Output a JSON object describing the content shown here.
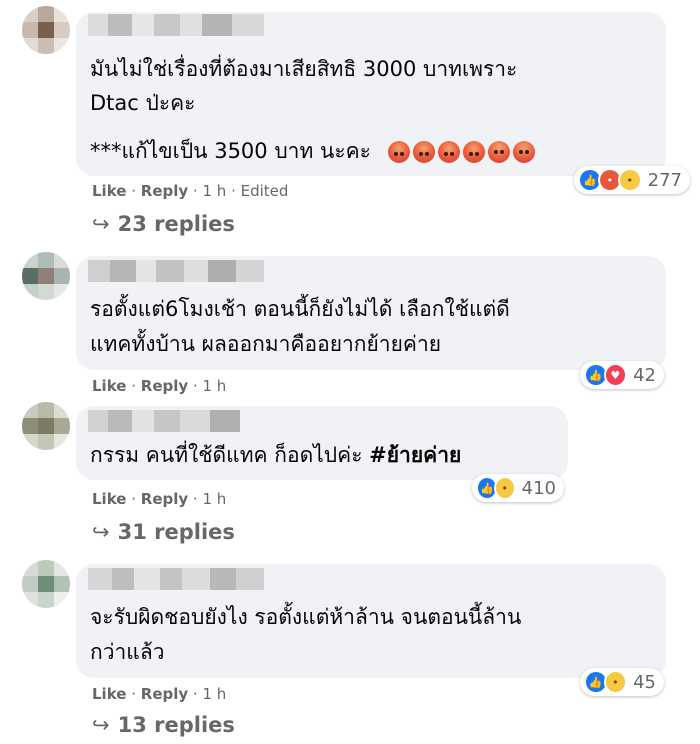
{
  "colors": {
    "bubble": "#f0f2f5",
    "meta": "#65676b",
    "text": "#050505",
    "like": "#1877f2"
  },
  "comments": [
    {
      "lines": [
        "มันไม่ใช่เรื่องที่ต้องมาเสียสิทธิ 3000 บาทเพราะ",
        "Dtac ป่ะคะ",
        "***แก้ไขเป็น 3500 บาท นะคะ"
      ],
      "emoji_count": 6,
      "actions": {
        "like": "Like",
        "reply": "Reply",
        "time": "1 h",
        "edited": "Edited"
      },
      "reaction_icons": [
        "like-icon",
        "angry-icon",
        "sad-icon"
      ],
      "reaction_count": "277",
      "replies": "23 replies"
    },
    {
      "lines": [
        "รอตั้งแต่6โมงเช้า ตอนนี้ก็ยังไม่ได้ เลือกใช้แต่ดี",
        "แทคทั้งบ้าน ผลออกมาคืออยากย้ายค่าย"
      ],
      "actions": {
        "like": "Like",
        "reply": "Reply",
        "time": "1 h"
      },
      "reaction_icons": [
        "like-icon",
        "love-icon"
      ],
      "reaction_count": "42"
    },
    {
      "lines": [
        "กรรม คนที่ใช้ดีแทค ก็อดไปค่ะ",
        "#ย้ายค่าย"
      ],
      "actions": {
        "like": "Like",
        "reply": "Reply",
        "time": "1 h"
      },
      "reaction_icons": [
        "like-icon",
        "sad-icon"
      ],
      "reaction_count": "410",
      "replies": "31 replies"
    },
    {
      "lines": [
        "จะรับผิดชอบยังไง รอตั้งแต่ห้าล้าน จนตอนนี้ล้าน",
        "กว่าแล้ว"
      ],
      "actions": {
        "like": "Like",
        "reply": "Reply",
        "time": "1 h"
      },
      "reaction_icons": [
        "like-icon",
        "sad-icon"
      ],
      "reaction_count": "45",
      "replies": "13 replies"
    }
  ]
}
